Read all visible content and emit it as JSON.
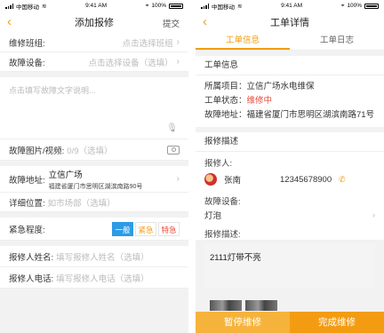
{
  "status_bar": {
    "carrier": "中国移动",
    "time": "9:41 AM",
    "battery": "100%"
  },
  "left": {
    "title": "添加报修",
    "back": "‹",
    "submit_label": "提交",
    "team": {
      "label": "维修班组:",
      "placeholder": "点击选择班组"
    },
    "device": {
      "label": "故障设备:",
      "placeholder": "点击选择设备（选填）"
    },
    "description_placeholder": "点击填写故障文字说明...",
    "media": {
      "label": "故障图片/视频:",
      "count": "0/9（选填）"
    },
    "address": {
      "label": "故障地址:",
      "name": "立信广场",
      "detail": "福建省厦门市思明区湖滨南路90号"
    },
    "location": {
      "label": "详细位置:",
      "placeholder": "如市场部（选填）"
    },
    "urgency": {
      "label": "紧急程度:",
      "options": [
        "一般",
        "紧急",
        "特急"
      ],
      "selected": "一般"
    },
    "reporter_name": {
      "label": "报修人姓名:",
      "placeholder": "填写报修人姓名（选填）"
    },
    "reporter_phone": {
      "label": "报修人电话:",
      "placeholder": "填写报修人电话（选填）"
    }
  },
  "right": {
    "title": "工单详情",
    "back": "‹",
    "tabs": [
      "工单信息",
      "工单日志"
    ],
    "active_tab": "工单信息",
    "info_section": "工单信息",
    "project": "所属项目：立信广场水电维保",
    "status_label": "工单状态：",
    "status_value": "维修中",
    "address": "故障地址：福建省厦门市思明区湖滨南路71号",
    "desc_section": "报修描述",
    "reporter_label": "报修人:",
    "reporter_name": "张南",
    "reporter_phone": "12345678900",
    "device_label": "故障设备:",
    "device_value": "灯泡",
    "desc_label": "报修描述:",
    "desc_text": "2111灯带不亮",
    "pause_label": "暂停维修",
    "done_label": "完成维修"
  },
  "colors": {
    "accent": "#f39c12",
    "blue": "#2e9be6",
    "red": "#e74c3c"
  }
}
